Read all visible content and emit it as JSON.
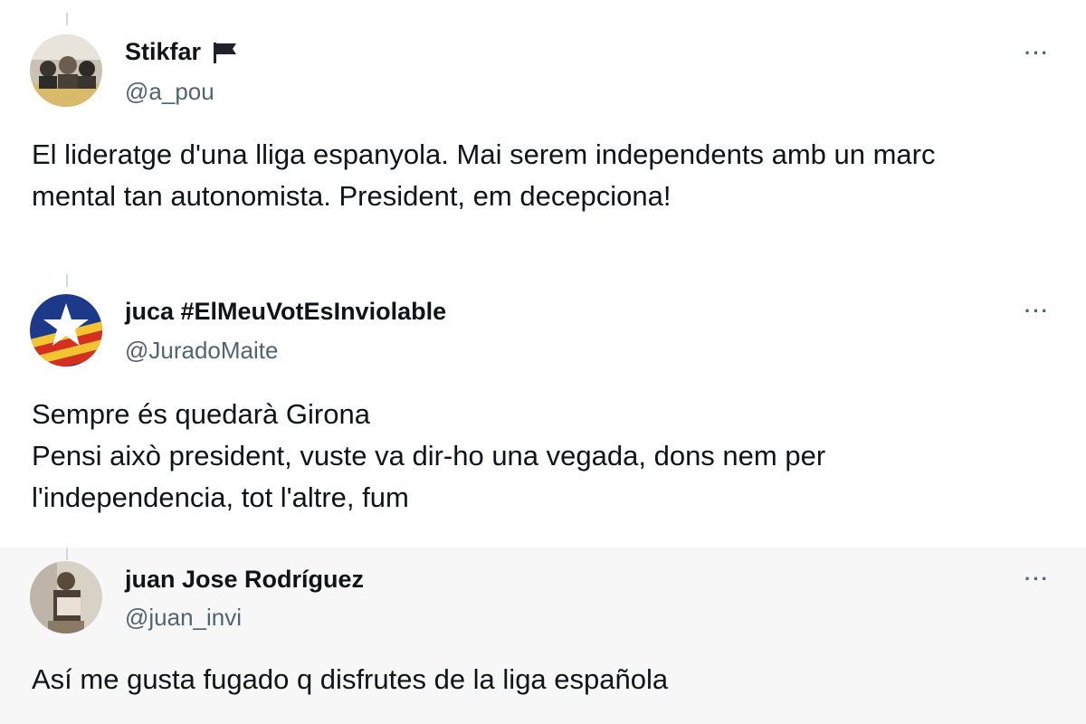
{
  "tweets": [
    {
      "name": "Stikfar",
      "name_icon": "flag-icon",
      "handle": "@a_pou",
      "lines": [
        "El lideratge d'una lliga espanyola. Mai serem independents amb un marc",
        "mental tan autonomista. President, em decepciona!"
      ],
      "more_label": "···"
    },
    {
      "name": "juca #ElMeuVotEsInviolable",
      "handle": "@JuradoMaite",
      "lines": [
        "Sempre és quedarà Girona",
        "Pensi això president, vuste va dir-ho una vegada, dons nem per",
        "l'independencia, tot l'altre, fum"
      ],
      "more_label": "···"
    },
    {
      "name": "juan Jose Rodríguez",
      "handle": "@juan_invi",
      "lines": [
        "Así me gusta fugado q disfrutes de la liga española"
      ],
      "more_label": "···"
    }
  ],
  "colors": {
    "text": "#0f1419",
    "secondary": "#536471",
    "thread_line": "#cfd9de"
  }
}
